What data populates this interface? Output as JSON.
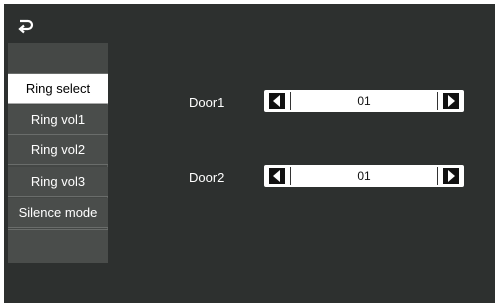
{
  "header": {
    "back_icon": "return-arrow-icon"
  },
  "sidebar": {
    "items": [
      {
        "label": "Ring select",
        "active": true
      },
      {
        "label": "Ring vol1",
        "active": false
      },
      {
        "label": "Ring vol2",
        "active": false
      },
      {
        "label": "Ring vol3",
        "active": false
      },
      {
        "label": "Silence mode",
        "active": false
      }
    ]
  },
  "main": {
    "rows": [
      {
        "label": "Door1",
        "value": "01"
      },
      {
        "label": "Door2",
        "value": "01"
      }
    ]
  },
  "colors": {
    "background": "#2d302f",
    "sidebar": "#4a4d4b",
    "active_item": "#ffffff",
    "text": "#ffffff"
  }
}
